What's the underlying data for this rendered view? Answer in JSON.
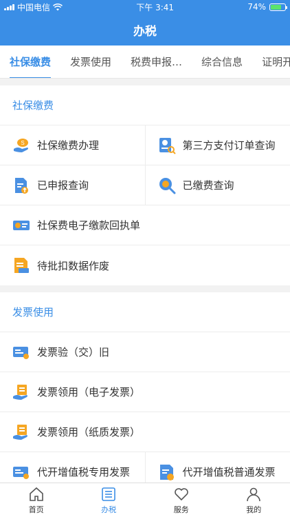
{
  "status": {
    "carrier": "中国电信",
    "time": "下午 3:41",
    "battery": "74%",
    "battery_level": 0.74
  },
  "navbar": {
    "title": "办税"
  },
  "tabs": [
    {
      "label": "社保缴费",
      "active": true
    },
    {
      "label": "发票使用"
    },
    {
      "label": "税费申报…"
    },
    {
      "label": "综合信息"
    },
    {
      "label": "证明开"
    }
  ],
  "sections": [
    {
      "title": "社保缴费",
      "items": [
        {
          "label": "社保缴费办理",
          "icon": "social-security-payment-icon"
        },
        {
          "label": "第三方支付订单查询",
          "icon": "third-party-order-query-icon"
        },
        {
          "label": "已申报查询",
          "icon": "declared-query-icon"
        },
        {
          "label": "已缴费查询",
          "icon": "paid-query-icon"
        },
        {
          "label": "社保费电子缴款回执单",
          "icon": "electronic-receipt-icon"
        },
        {
          "label": "待批扣数据作废",
          "icon": "pending-data-void-icon"
        }
      ]
    },
    {
      "title": "发票使用",
      "items": [
        {
          "label": "发票验（交）旧",
          "icon": "invoice-verify-icon"
        },
        {
          "label": "发票领用（电子发票）",
          "icon": "invoice-receive-electronic-icon"
        },
        {
          "label": "发票领用（纸质发票）",
          "icon": "invoice-receive-paper-icon"
        },
        {
          "label": "代开增值税专用发票",
          "icon": "vat-special-invoice-icon"
        },
        {
          "label": "代开增值税普通发票",
          "icon": "vat-ordinary-invoice-icon"
        }
      ]
    }
  ],
  "tabbar": [
    {
      "label": "首页",
      "icon": "home-icon"
    },
    {
      "label": "办税",
      "icon": "list-icon",
      "active": true
    },
    {
      "label": "服务",
      "icon": "heart-icon"
    },
    {
      "label": "我的",
      "icon": "user-icon"
    }
  ],
  "colors": {
    "brand": "#3a8ee6",
    "icon_orange": "#f5a623",
    "icon_blue": "#4a90e2"
  }
}
